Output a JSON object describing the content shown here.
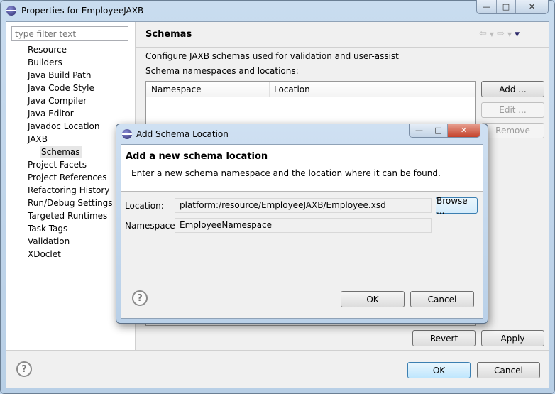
{
  "window": {
    "title": "Properties for EmployeeJAXB",
    "controls": {
      "minimize": "—",
      "maximize": "□",
      "close": "✕"
    }
  },
  "sidebar": {
    "filter_placeholder": "type filter text",
    "items": [
      {
        "label": "Resource"
      },
      {
        "label": "Builders"
      },
      {
        "label": "Java Build Path"
      },
      {
        "label": "Java Code Style"
      },
      {
        "label": "Java Compiler"
      },
      {
        "label": "Java Editor"
      },
      {
        "label": "Javadoc Location"
      },
      {
        "label": "JAXB"
      },
      {
        "label": "Schemas",
        "selected": true,
        "child": true
      },
      {
        "label": "Project Facets"
      },
      {
        "label": "Project References"
      },
      {
        "label": "Refactoring History"
      },
      {
        "label": "Run/Debug Settings"
      },
      {
        "label": "Targeted Runtimes"
      },
      {
        "label": "Task Tags"
      },
      {
        "label": "Validation"
      },
      {
        "label": "XDoclet"
      }
    ]
  },
  "page": {
    "title": "Schemas",
    "description": "Configure JAXB schemas used for validation and user-assist",
    "table_label": "Schema namespaces and locations:",
    "columns": [
      "Namespace",
      "Location"
    ],
    "buttons": {
      "add": "Add ...",
      "edit": "Edit ...",
      "remove": "Remove",
      "revert": "Revert",
      "apply": "Apply"
    }
  },
  "footer": {
    "help": "?",
    "ok": "OK",
    "cancel": "Cancel"
  },
  "dialog": {
    "title": "Add Schema Location",
    "heading": "Add a new schema location",
    "message": "Enter a new schema namespace and the location where it can be found.",
    "location_label": "Location:",
    "location_value": "platform:/resource/EmployeeJAXB/Employee.xsd",
    "browse": "Browse ...",
    "namespace_label": "Namespace:",
    "namespace_value": "EmployeeNamespace",
    "help": "?",
    "ok": "OK",
    "cancel": "Cancel"
  }
}
